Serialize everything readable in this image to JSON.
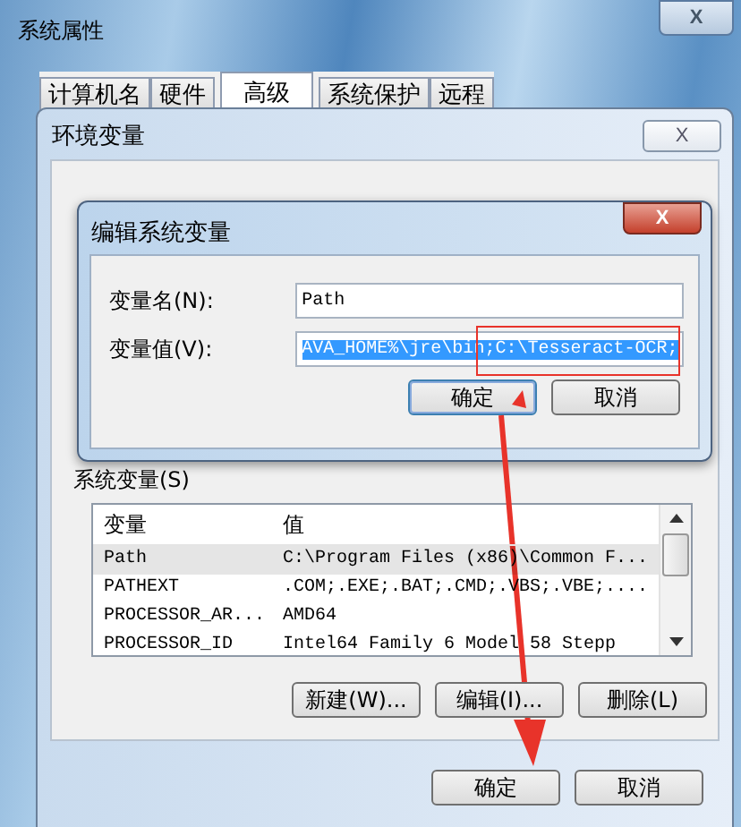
{
  "window": {
    "title": "系统属性",
    "close": "X"
  },
  "tabs": [
    {
      "label": "计算机名",
      "selected": false
    },
    {
      "label": "硬件",
      "selected": false
    },
    {
      "label": "高级",
      "selected": true
    },
    {
      "label": "系统保护",
      "selected": false
    },
    {
      "label": "远程",
      "selected": false
    }
  ],
  "env_dialog": {
    "title": "环境变量",
    "close": "X",
    "system_vars": {
      "label": "系统变量(S)",
      "columns": [
        "变量",
        "值"
      ],
      "rows": [
        {
          "name": "Path",
          "value": "C:\\Program Files (x86)\\Common F...",
          "selected": true
        },
        {
          "name": "PATHEXT",
          "value": ".COM;.EXE;.BAT;.CMD;.VBS;.VBE;....",
          "selected": false
        },
        {
          "name": "PROCESSOR_AR...",
          "value": "AMD64",
          "selected": false
        },
        {
          "name": "PROCESSOR_ID",
          "value": "Intel64 Family 6 Model 58 Stepp",
          "selected": false
        }
      ],
      "buttons": [
        "新建(W)...",
        "编辑(I)...",
        "删除(L)"
      ]
    },
    "buttons": [
      "确定",
      "取消"
    ]
  },
  "edit_dialog": {
    "title": "编辑系统变量",
    "close": "X",
    "fields": [
      {
        "label": "变量名(N):",
        "value": "Path",
        "selected": false
      },
      {
        "label": "变量值(V):",
        "value": "AVA_HOME%\\jre\\bin;C:\\Tesseract-OCR;",
        "selected": true
      }
    ],
    "buttons": [
      "确定",
      "取消"
    ]
  }
}
